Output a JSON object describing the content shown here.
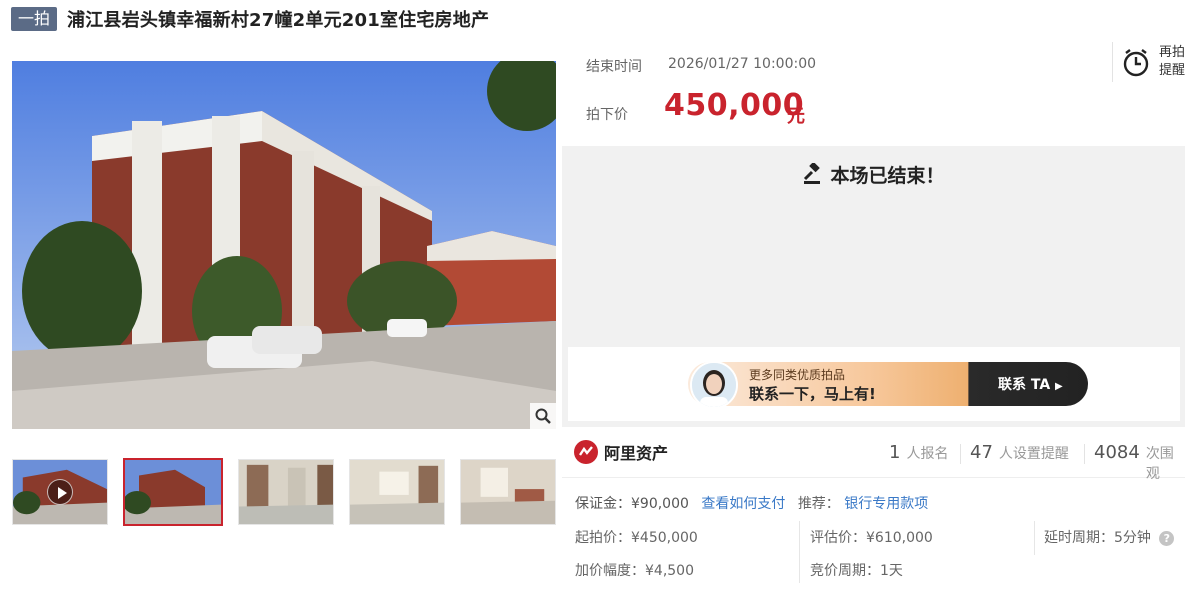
{
  "header": {
    "round_badge": "一拍",
    "title": "浦江县岩头镇幸福新村27幢2单元201室住宅房地产"
  },
  "auction": {
    "end_time_label": "结束时间",
    "end_time_value": "2026/01/27 10:00:00",
    "price_label": "拍下价",
    "price_value": "450,000",
    "price_unit": "元",
    "remind_label": "再拍提醒",
    "status_text": "本场已结束！"
  },
  "promo": {
    "line1": "更多同类优质拍品",
    "line2": "联系一下，马上有!",
    "cta": "联系 TA"
  },
  "stats": {
    "brand": "阿里资产",
    "signups_num": "1",
    "signups_label": "人报名",
    "reminders_num": "47",
    "reminders_label": "人设置提醒",
    "views_num": "4084",
    "views_label": "次围观"
  },
  "details": {
    "deposit": "保证金：¥90,000",
    "how_to_pay": "查看如何支付",
    "recommend_label": "推荐：",
    "recommend_link": "银行专用款项",
    "start_price": "起拍价：¥450,000",
    "valuation": "评估价：¥610,000",
    "delay": "延时周期：5分钟",
    "increment": "加价幅度：¥4,500",
    "cycle": "竞价周期：1天"
  },
  "colors": {
    "accent": "#c9232d",
    "badge": "#5b6b86",
    "link": "#3a79c7"
  }
}
